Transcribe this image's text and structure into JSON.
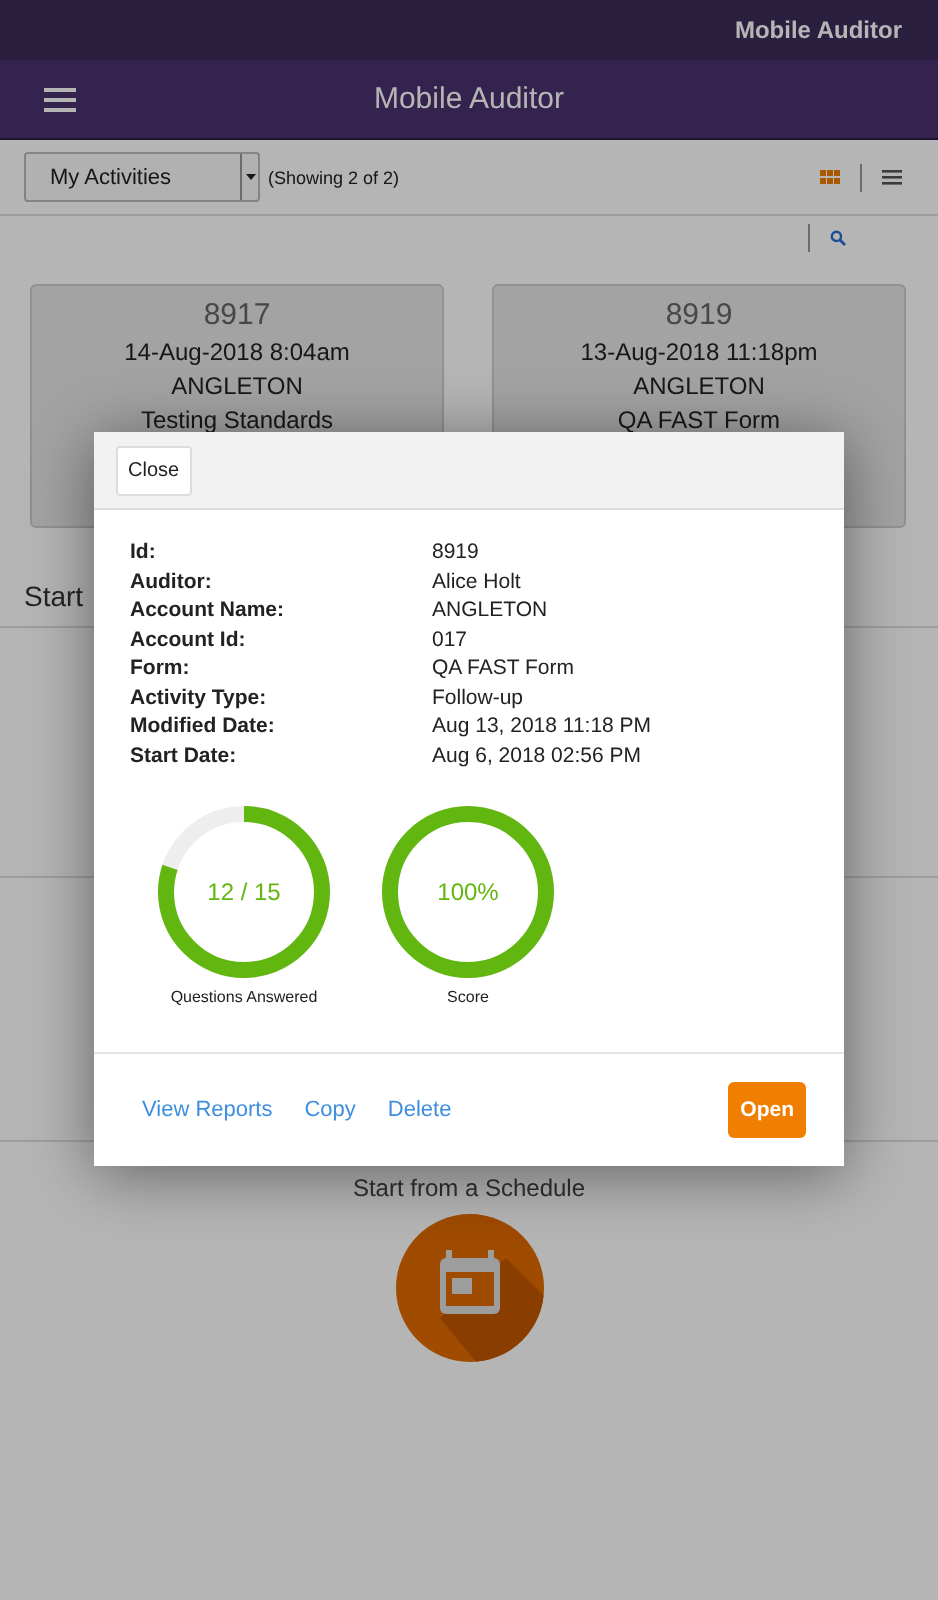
{
  "status_bar": {
    "title": "Mobile Auditor"
  },
  "header": {
    "title": "Mobile Auditor"
  },
  "toolbar": {
    "filter": "My Activities",
    "count": "(Showing 2 of 2)",
    "views": [
      {
        "kind": "grid",
        "selected": true
      },
      {
        "kind": "list",
        "selected": false
      }
    ]
  },
  "cards": [
    {
      "id": "8917",
      "date": "14-Aug-2018 8:04am",
      "account": "ANGLETON",
      "form": "Testing Standards"
    },
    {
      "id": "8919",
      "date": "13-Aug-2018 11:18pm",
      "account": "ANGLETON",
      "form": "QA FAST Form"
    }
  ],
  "section_label": "Start",
  "schedule": {
    "label": "Start from a Schedule"
  },
  "dialog": {
    "close": "Close",
    "details": [
      {
        "label": "Id:",
        "value": "8919"
      },
      {
        "label": "Auditor:",
        "value": "Alice Holt"
      },
      {
        "label": "Account Name:",
        "value": "ANGLETON"
      },
      {
        "label": "Account Id:",
        "value": "017"
      },
      {
        "label": "Form:",
        "value": "QA FAST Form"
      },
      {
        "label": "Activity Type:",
        "value": "Follow-up"
      },
      {
        "label": "Modified Date:",
        "value": "Aug 13, 2018 11:18 PM"
      },
      {
        "label": "Start Date:",
        "value": "Aug 6, 2018 02:56 PM"
      }
    ],
    "gauges": [
      {
        "value": "12 / 15",
        "caption": "Questions Answered",
        "level": 0.8
      },
      {
        "value": "100%",
        "caption": "Score",
        "level": 1
      }
    ],
    "links": [
      "View Reports",
      "Copy",
      "Delete"
    ],
    "primary": "Open"
  }
}
